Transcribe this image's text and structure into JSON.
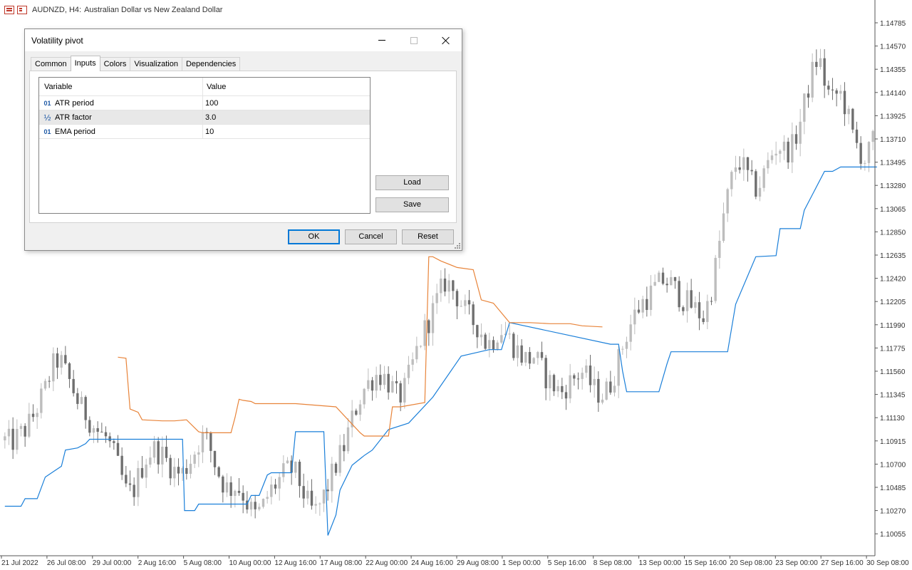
{
  "chart": {
    "symbol": "AUDNZD, H4:",
    "description": "Australian Dollar vs New Zealand Dollar",
    "icons": [
      "chart-table-icon",
      "one-click-trading-icon"
    ],
    "colors": {
      "bull": "#bdbdbd",
      "bear": "#6f6f6f",
      "support": "#1a7fd9",
      "resistance": "#e8843a",
      "axis": "#555555"
    }
  },
  "chart_data": {
    "type": "line",
    "price_axis": [
      "1.14785",
      "1.14570",
      "1.14355",
      "1.14140",
      "1.13925",
      "1.13710",
      "1.13495",
      "1.13280",
      "1.13065",
      "1.12850",
      "1.12635",
      "1.12420",
      "1.12205",
      "1.11990",
      "1.11775",
      "1.11560",
      "1.11345",
      "1.11130",
      "1.10915",
      "1.10700",
      "1.10485",
      "1.10270",
      "1.10055"
    ],
    "time_axis": [
      "21 Jul 2022",
      "26 Jul 08:00",
      "29 Jul 00:00",
      "2 Aug 16:00",
      "5 Aug 08:00",
      "10 Aug 00:00",
      "12 Aug 16:00",
      "17 Aug 08:00",
      "22 Aug 00:00",
      "24 Aug 16:00",
      "29 Aug 08:00",
      "1 Sep 00:00",
      "5 Sep 16:00",
      "8 Sep 08:00",
      "13 Sep 00:00",
      "15 Sep 16:00",
      "20 Sep 08:00",
      "23 Sep 00:00",
      "27 Sep 16:00",
      "30 Sep 08:00"
    ],
    "close_path": [
      1.1092,
      1.109,
      1.1096,
      1.1102,
      1.1112,
      1.1126,
      1.114,
      1.116,
      1.1168,
      1.1154,
      1.114,
      1.1124,
      1.1116,
      1.1106,
      1.1098,
      1.1094,
      1.108,
      1.1062,
      1.1042,
      1.1046,
      1.1064,
      1.1078,
      1.1084,
      1.108,
      1.1072,
      1.1064,
      1.106,
      1.107,
      1.1082,
      1.1096,
      1.109,
      1.107,
      1.1054,
      1.1046,
      1.105,
      1.1044,
      1.103,
      1.1022,
      1.103,
      1.1044,
      1.1052,
      1.106,
      1.1066,
      1.106,
      1.1044,
      1.1028,
      1.1026,
      1.104,
      1.1056,
      1.1072,
      1.1086,
      1.1108,
      1.1126,
      1.114,
      1.1148,
      1.1154,
      1.115,
      1.1142,
      1.113,
      1.114,
      1.116,
      1.118,
      1.1196,
      1.121,
      1.1226,
      1.124,
      1.1232,
      1.1222,
      1.121,
      1.1202,
      1.1196,
      1.118,
      1.1186,
      1.1196,
      1.119,
      1.118,
      1.1172,
      1.1166,
      1.117,
      1.116,
      1.1148,
      1.1142,
      1.1136,
      1.1144,
      1.115,
      1.1156,
      1.1148,
      1.1138,
      1.1134,
      1.114,
      1.1156,
      1.1178,
      1.1196,
      1.121,
      1.122,
      1.1226,
      1.1234,
      1.124,
      1.1238,
      1.123,
      1.1222,
      1.1218,
      1.1212,
      1.1206,
      1.1226,
      1.126,
      1.13,
      1.133,
      1.1352,
      1.1344,
      1.133,
      1.1324,
      1.134,
      1.1356,
      1.1366,
      1.136,
      1.1362,
      1.138,
      1.1406,
      1.1432,
      1.1448,
      1.142,
      1.1406,
      1.1416,
      1.14,
      1.1374,
      1.136,
      1.135,
      1.137
    ],
    "support_line": [
      [
        0,
        1.1031
      ],
      [
        4,
        1.1031
      ],
      [
        5,
        1.1038
      ],
      [
        8,
        1.1038
      ],
      [
        10,
        1.1058
      ],
      [
        12,
        1.1063
      ],
      [
        14,
        1.1068
      ],
      [
        15,
        1.1083
      ],
      [
        18,
        1.1085
      ],
      [
        20,
        1.1089
      ],
      [
        21,
        1.1093
      ],
      [
        27,
        1.1093
      ],
      [
        28,
        1.1093
      ],
      [
        44,
        1.1093
      ],
      [
        44.5,
        1.1027
      ],
      [
        47,
        1.1027
      ],
      [
        48,
        1.1033
      ],
      [
        60,
        1.1033
      ],
      [
        61,
        1.1041
      ],
      [
        63,
        1.1041
      ],
      [
        65,
        1.106
      ],
      [
        66,
        1.1062
      ],
      [
        71,
        1.1062
      ],
      [
        72,
        1.11
      ],
      [
        79,
        1.11
      ],
      [
        80,
        1.1004
      ],
      [
        82,
        1.1023
      ],
      [
        83,
        1.1046
      ],
      [
        86,
        1.1069
      ],
      [
        89,
        1.1078
      ],
      [
        91,
        1.1083
      ],
      [
        95,
        1.1102
      ],
      [
        100,
        1.1108
      ],
      [
        106,
        1.1132
      ],
      [
        113,
        1.117
      ],
      [
        120,
        1.1176
      ],
      [
        123,
        1.1176
      ],
      [
        125,
        1.1201
      ],
      [
        150,
        1.1181
      ],
      [
        152,
        1.1181
      ],
      [
        153,
        1.1156
      ],
      [
        154,
        1.1137
      ],
      [
        162,
        1.1137
      ],
      [
        164,
        1.1163
      ],
      [
        165,
        1.1174
      ],
      [
        179,
        1.1174
      ],
      [
        181,
        1.1218
      ],
      [
        186,
        1.1262
      ],
      [
        191,
        1.1263
      ],
      [
        192,
        1.1288
      ],
      [
        197,
        1.1288
      ],
      [
        198,
        1.1305
      ],
      [
        203,
        1.1341
      ],
      [
        205,
        1.1341
      ],
      [
        207,
        1.1345
      ],
      [
        210,
        1.1345
      ],
      [
        216,
        1.1345
      ]
    ],
    "resistance_line": [
      [
        28,
        1.1169
      ],
      [
        30,
        1.1168
      ],
      [
        31,
        1.1121
      ],
      [
        33,
        1.1118
      ],
      [
        34,
        1.1111
      ],
      [
        39,
        1.111
      ],
      [
        42,
        1.111
      ],
      [
        45,
        1.1111
      ],
      [
        48,
        1.11
      ],
      [
        49,
        1.1099
      ],
      [
        56,
        1.1099
      ],
      [
        57,
        1.1113
      ],
      [
        58,
        1.113
      ],
      [
        59,
        1.1129
      ],
      [
        61,
        1.1128
      ],
      [
        62,
        1.1126
      ],
      [
        72,
        1.1126
      ],
      [
        82,
        1.1123
      ],
      [
        88,
        1.1099
      ],
      [
        89,
        1.1096
      ],
      [
        95,
        1.1096
      ],
      [
        96,
        1.1123
      ],
      [
        98,
        1.1123
      ],
      [
        104,
        1.1127
      ],
      [
        105,
        1.1262
      ],
      [
        106,
        1.1262
      ],
      [
        108,
        1.1258
      ],
      [
        112,
        1.1252
      ],
      [
        116,
        1.125
      ],
      [
        118,
        1.1222
      ],
      [
        121,
        1.1219
      ],
      [
        125,
        1.1201
      ],
      [
        130,
        1.1201
      ],
      [
        135,
        1.12
      ],
      [
        140,
        1.12
      ],
      [
        143,
        1.1198
      ],
      [
        148,
        1.1197
      ]
    ]
  },
  "dialog": {
    "title": "Volatility pivot",
    "tabs": [
      "Common",
      "Inputs",
      "Colors",
      "Visualization",
      "Dependencies"
    ],
    "active_tab": "Inputs",
    "table": {
      "headers": [
        "Variable",
        "Value"
      ],
      "rows": [
        {
          "type": "01",
          "type_icon": "integer-type-icon",
          "variable": "ATR period",
          "value": "100"
        },
        {
          "type": "½",
          "type_icon": "double-type-icon",
          "variable": "ATR factor",
          "value": "3.0"
        },
        {
          "type": "01",
          "type_icon": "integer-type-icon",
          "variable": "EMA period",
          "value": "10"
        }
      ]
    },
    "buttons": {
      "load": "Load",
      "save": "Save",
      "ok": "OK",
      "cancel": "Cancel",
      "reset": "Reset"
    }
  }
}
